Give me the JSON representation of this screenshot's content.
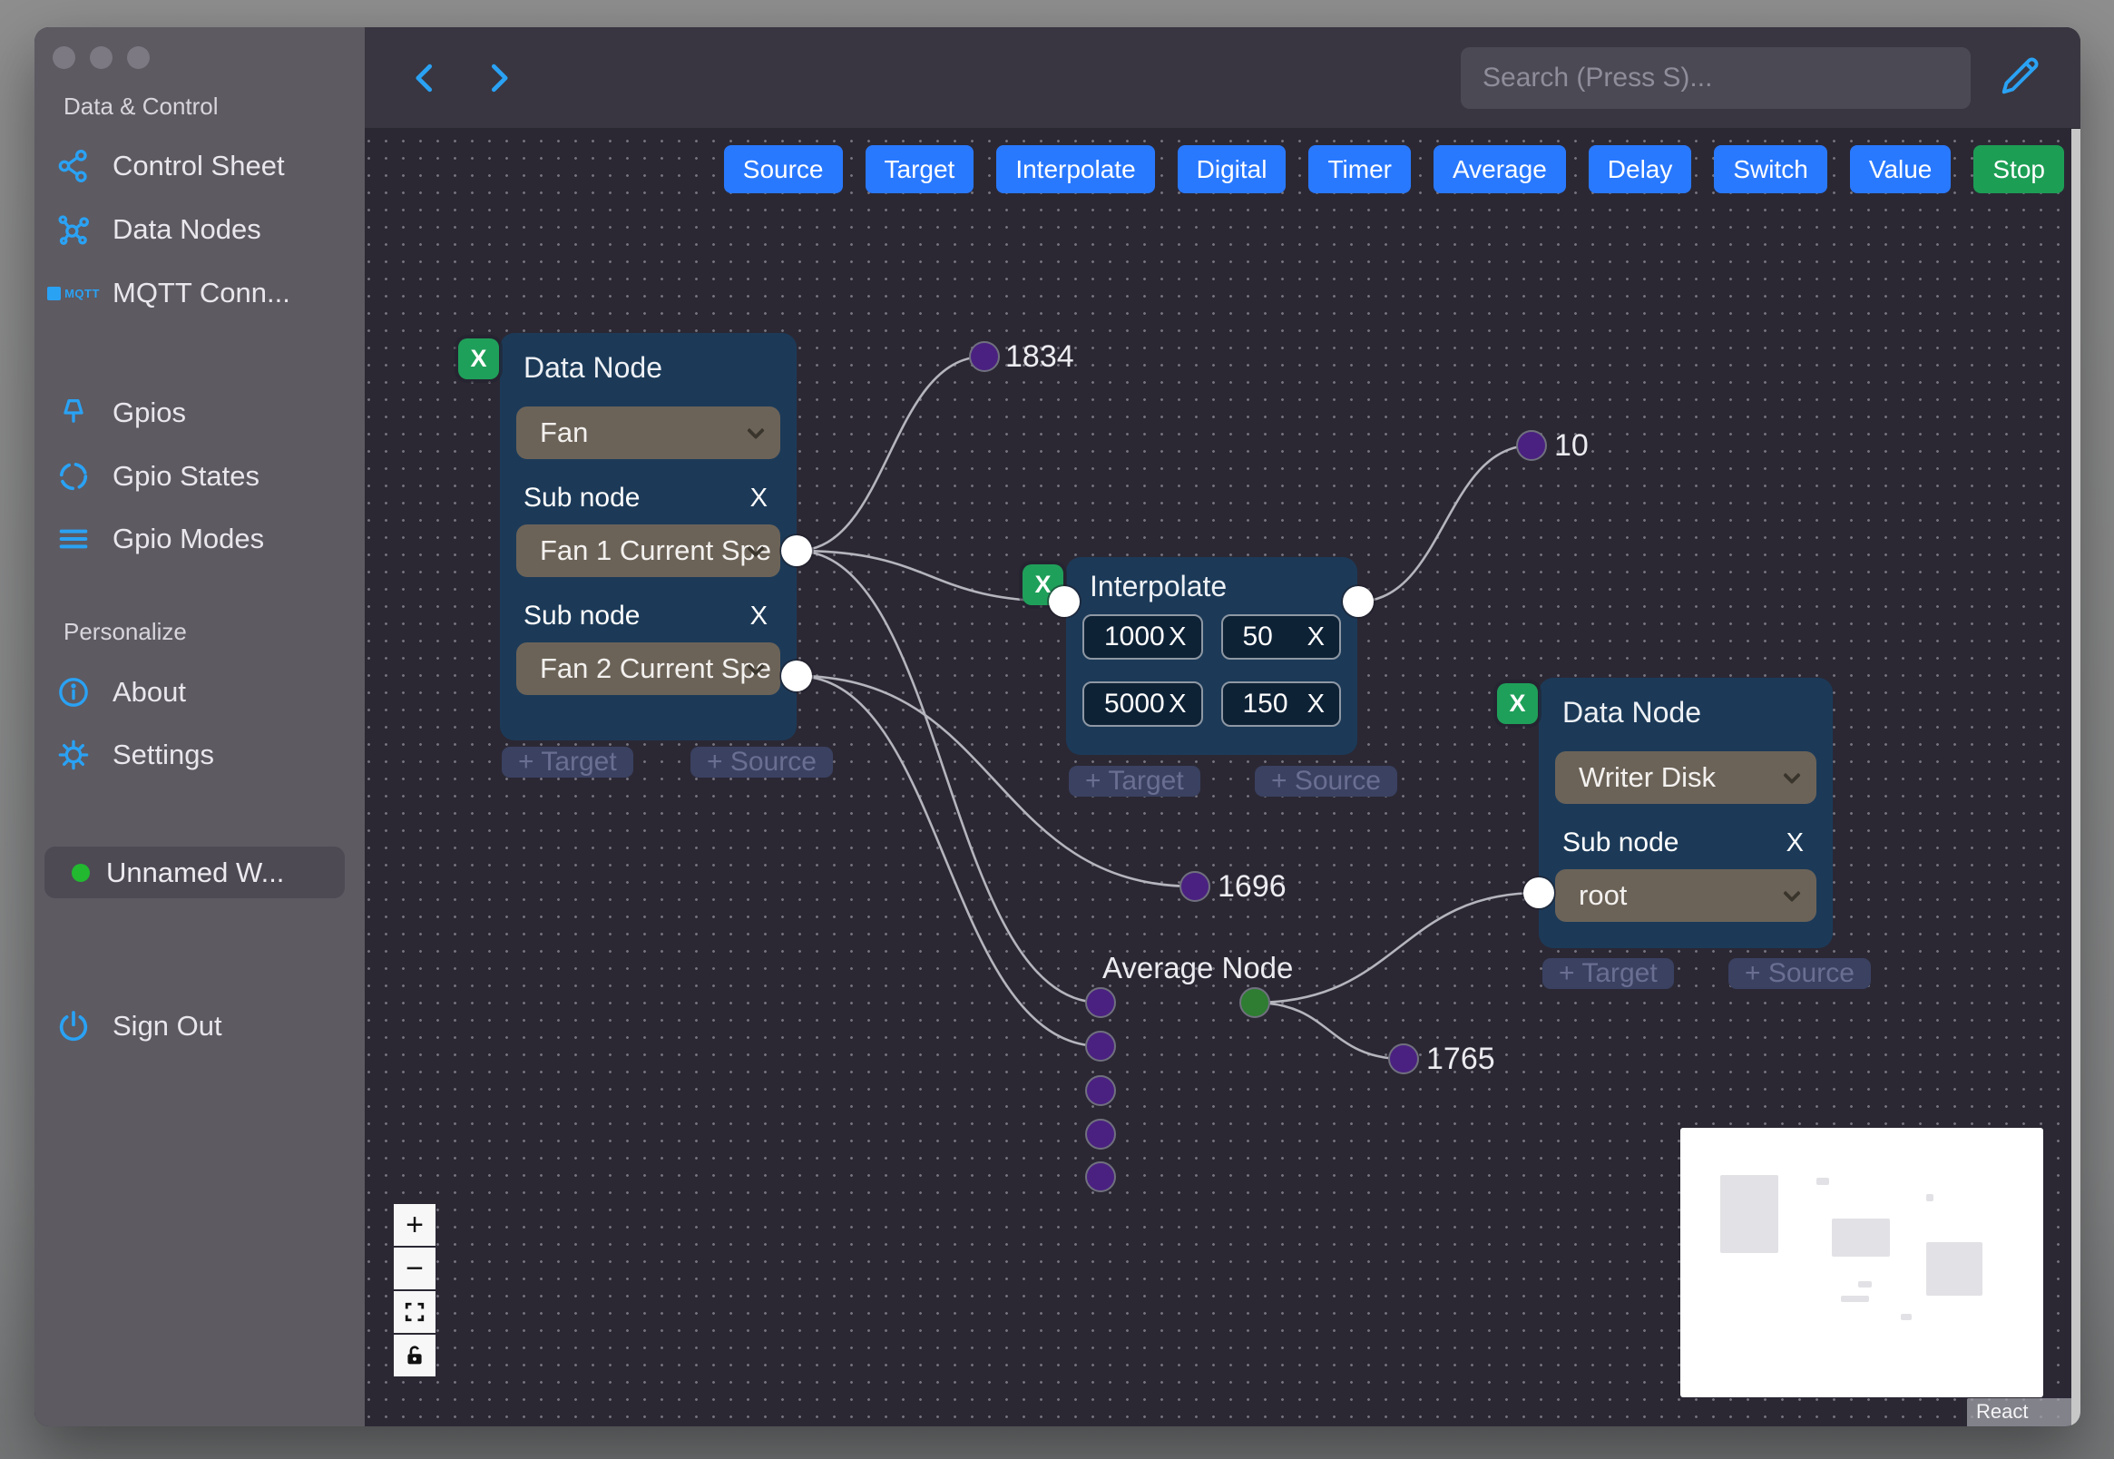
{
  "colors": {
    "accent_blue": "#2979ff",
    "stop_green": "#1d9e55",
    "icon_blue": "#2aa2f4",
    "node_bg": "#1c3a58",
    "select_bg": "#6c6358",
    "canvas_bg": "#2b2834",
    "sidebar_bg": "#5d5a62",
    "topbar_bg": "#393641",
    "edge_gray": "#b5b5bd",
    "purple_handle": "#4a2181",
    "green_handle": "#2e7d32",
    "workspace_status_green": "#22b830"
  },
  "sidebar": {
    "header_data_control": "Data & Control",
    "control_sheet": "Control Sheet",
    "data_nodes": "Data Nodes",
    "mqtt": "MQTT Conn...",
    "mqtt_icon_text": "MQTT",
    "gpios": "Gpios",
    "gpio_states": "Gpio States",
    "gpio_modes": "Gpio Modes",
    "header_personalize": "Personalize",
    "about": "About",
    "settings": "Settings",
    "workspace": "Unnamed W...",
    "sign_out": "Sign Out"
  },
  "topbar": {
    "search_placeholder": "Search (Press S)..."
  },
  "toolbar": {
    "buttons": [
      {
        "label": "Source"
      },
      {
        "label": "Target"
      },
      {
        "label": "Interpolate"
      },
      {
        "label": "Digital"
      },
      {
        "label": "Timer"
      },
      {
        "label": "Average"
      },
      {
        "label": "Delay"
      },
      {
        "label": "Switch"
      },
      {
        "label": "Value"
      },
      {
        "label": "Stop"
      }
    ]
  },
  "canvas": {
    "x_label": "X",
    "add_target_label": "+ Target",
    "add_source_label": "+ Source",
    "fan_node": {
      "title": "Data Node",
      "device": "Fan",
      "sub1_label": "Sub node",
      "sub1_value": "Fan 1 Current Spe",
      "sub2_label": "Sub node",
      "sub2_value": "Fan 2 Current Spe"
    },
    "interpolate_node": {
      "title": "Interpolate",
      "r1c1": "1000",
      "r1c2": "50",
      "r2c1": "5000",
      "r2c2": "150"
    },
    "writer_node": {
      "title": "Data Node",
      "device": "Writer Disk",
      "sub_label": "Sub node",
      "sub_value": "root"
    },
    "average_node_label": "Average Node",
    "float_values": [
      {
        "text": "1834"
      },
      {
        "text": "10"
      },
      {
        "text": "1696"
      },
      {
        "text": "1765"
      }
    ],
    "attribution": "React Flow"
  },
  "controls": {
    "zoom_in": "+",
    "zoom_out": "−"
  }
}
